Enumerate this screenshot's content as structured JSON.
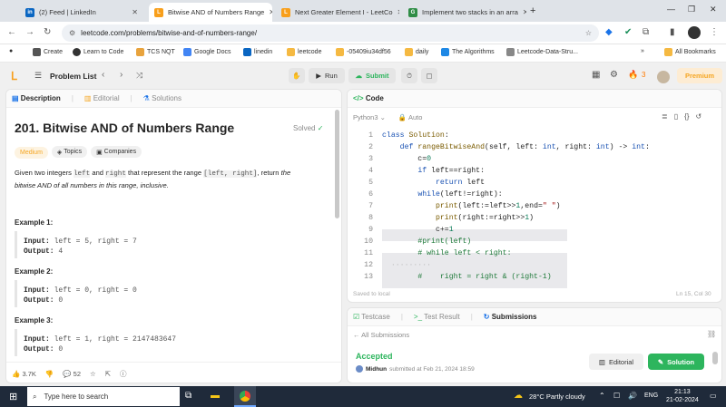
{
  "browser": {
    "tabs": [
      {
        "title": "(2) Feed | LinkedIn",
        "icon": "linkedin-icon",
        "color": "#0a66c2",
        "glyph": "in"
      },
      {
        "title": "Bitwise AND of Numbers Range",
        "icon": "leetcode-icon",
        "color": "#f89f1b",
        "glyph": "L"
      },
      {
        "title": "Next Greater Element I - LeetCo",
        "icon": "leetcode-icon",
        "color": "#f89f1b",
        "glyph": "L"
      },
      {
        "title": "Implement two stacks in an arra",
        "icon": "gfg-icon",
        "color": "#2f8d46",
        "glyph": "G"
      }
    ],
    "url": "leetcode.com/problems/bitwise-and-of-numbers-range/",
    "bookmarks": [
      {
        "label": "Create",
        "color": "#555"
      },
      {
        "label": "Learn to Code",
        "color": "#333"
      },
      {
        "label": "TCS NQT",
        "color": "#e8a33d"
      },
      {
        "label": "Google Docs",
        "color": "#4285f4"
      },
      {
        "label": "linedin",
        "color": "#0a66c2"
      },
      {
        "label": "leetcode",
        "color": "#f5b942"
      },
      {
        "label": "-05409iu34df56",
        "color": "#f5b942"
      },
      {
        "label": "daily",
        "color": "#f5b942"
      },
      {
        "label": "The Algorithms",
        "color": "#1e88e5"
      },
      {
        "label": "Leetcode-Data-Stru...",
        "color": "#888"
      }
    ],
    "all_bookmarks": "All Bookmarks"
  },
  "toolbar": {
    "problem_list": "Problem List",
    "run": "Run",
    "submit": "Submit",
    "streak": "3",
    "premium": "Premium"
  },
  "description": {
    "tabs": [
      "Description",
      "Editorial",
      "Solutions"
    ],
    "title": "201. Bitwise AND of Numbers Range",
    "solved": "Solved",
    "difficulty": "Medium",
    "topics": "Topics",
    "companies": "Companies",
    "text_1": "Given two integers ",
    "left": "left",
    "text_2": " and ",
    "right": "right",
    "text_3": " that represent the range ",
    "range": "[left, right]",
    "text_4": ", return ",
    "text_5": "the",
    "text_6": "bitwise AND of all numbers in this range, inclusive.",
    "examples": [
      {
        "heading": "Example 1:",
        "input_label": "Input:",
        "input": " left = 5, right = 7",
        "output_label": "Output:",
        "output": " 4"
      },
      {
        "heading": "Example 2:",
        "input_label": "Input:",
        "input": " left = 0, right = 0",
        "output_label": "Output:",
        "output": " 0"
      },
      {
        "heading": "Example 3:",
        "input_label": "Input:",
        "input": " left = 1, right = 2147483647",
        "output_label": "Output:",
        "output": " 0"
      }
    ],
    "likes": "3.7K",
    "comments": "52"
  },
  "code": {
    "header": "Code",
    "language": "Python3",
    "auto": "Auto",
    "saved": "Saved to local",
    "cursor": "Ln 15, Col 30",
    "line_numbers": [
      "1",
      "2",
      "3",
      "4",
      "5",
      "6",
      "7",
      "8",
      "9",
      "10",
      "11",
      "12",
      "13"
    ]
  },
  "submissions": {
    "tabs": [
      "Testcase",
      "Test Result",
      "Submissions"
    ],
    "all": "All Submissions",
    "status": "Accepted",
    "user": "Midhun",
    "meta": "submitted at Feb 21, 2024 18:59",
    "editorial": "Editorial",
    "solution": "Solution"
  },
  "taskbar": {
    "search": "Type here to search",
    "weather": "28°C  Partly cloudy",
    "lang": "ENG",
    "time": "21:13",
    "date": "21-02-2024"
  }
}
